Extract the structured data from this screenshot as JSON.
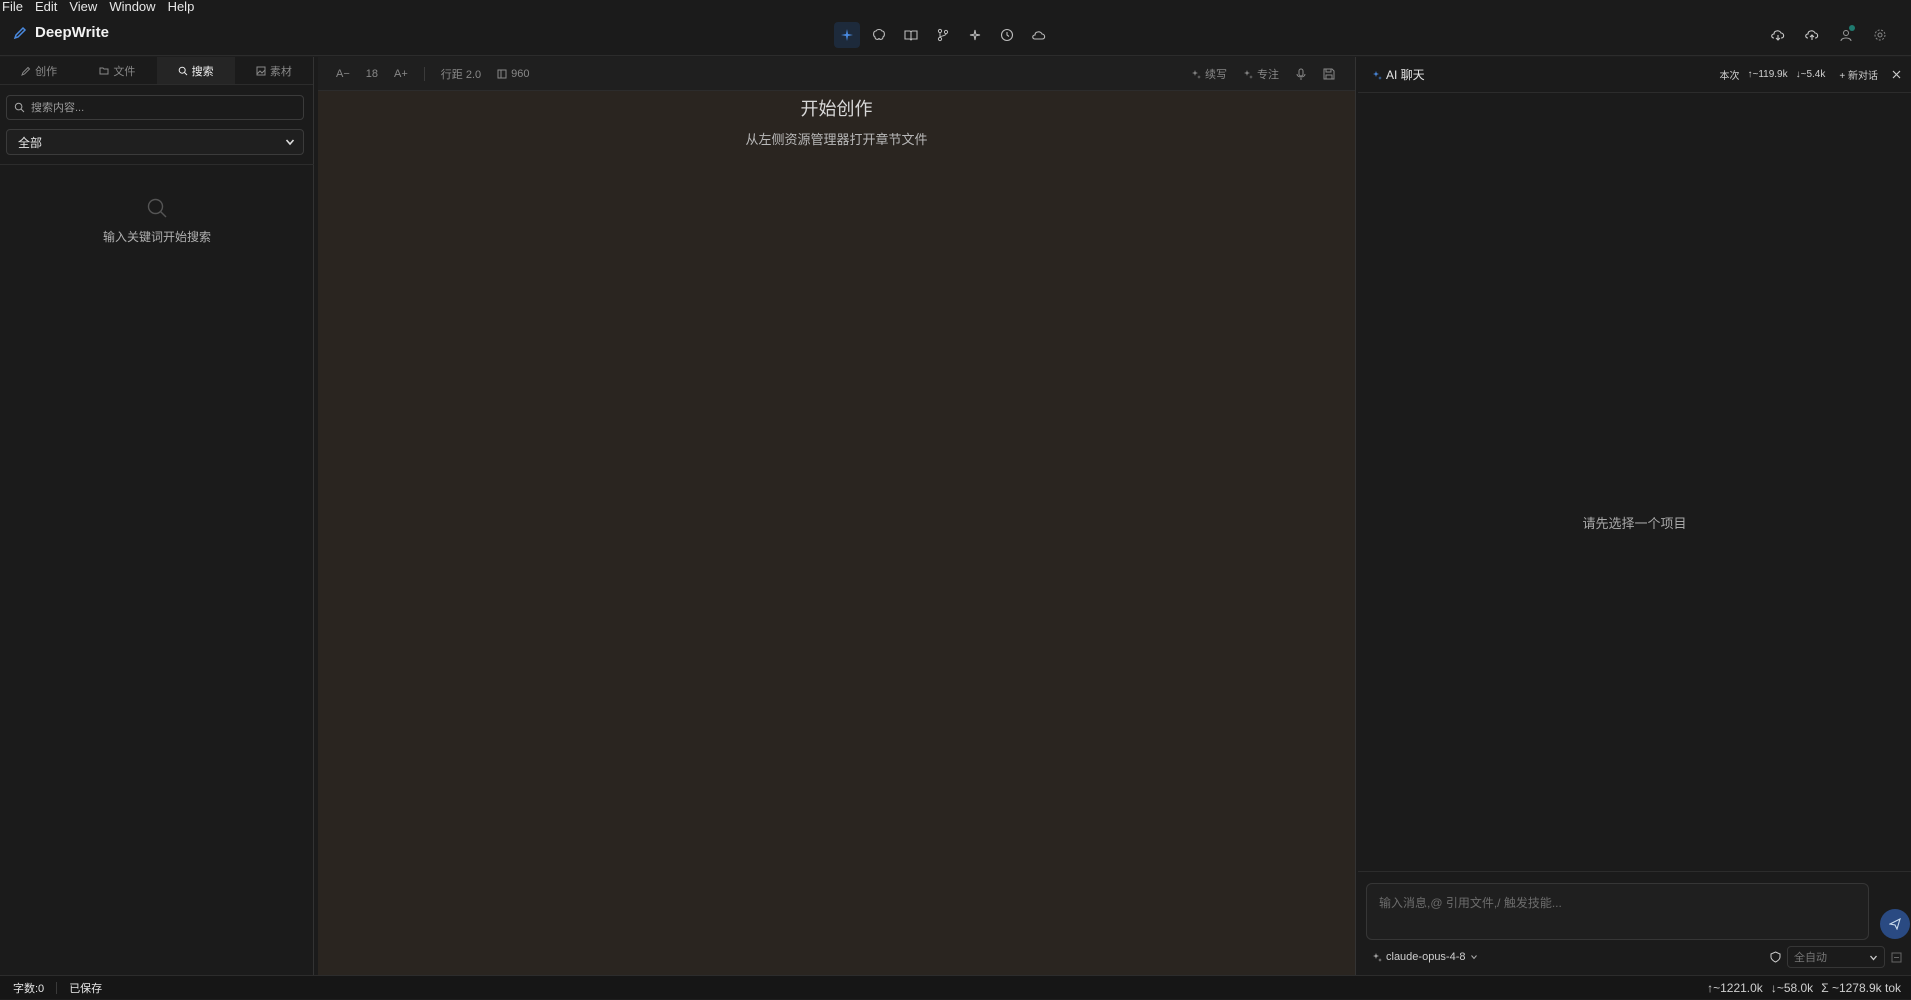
{
  "menubar": {
    "items": [
      "File",
      "Edit",
      "View",
      "Window",
      "Help"
    ]
  },
  "app": {
    "title": "DeepWrite"
  },
  "toolbar_icons": [
    "sparkles-icon",
    "brain-icon",
    "book-icon",
    "branch-icon",
    "magic-icon",
    "history-icon",
    "cloud-icon"
  ],
  "sidebar": {
    "tabs": [
      {
        "label": "创作",
        "icon": "pen-icon"
      },
      {
        "label": "文件",
        "icon": "folder-icon"
      },
      {
        "label": "搜索",
        "icon": "search-icon"
      },
      {
        "label": "素材",
        "icon": "image-icon"
      }
    ],
    "search_placeholder": "搜索内容...",
    "filter_value": "全部",
    "empty_text": "输入关键词开始搜索"
  },
  "editor": {
    "toolbar": {
      "font_decrease": "A−",
      "font_size": "18",
      "font_increase": "A+",
      "line_height": "行距 2.0",
      "width": "960",
      "continue_label": "续写",
      "focus_label": "专注"
    },
    "title": "开始创作",
    "subtitle": "从左侧资源管理器打开章节文件"
  },
  "chat": {
    "title": "AI 聊天",
    "session_label": "本次",
    "tokens_up": "↑~119.9k",
    "tokens_down": "↓~5.4k",
    "new_chat": "+ 新对话",
    "empty_text": "请先选择一个项目",
    "input_placeholder": "输入消息,@ 引用文件,/ 触发技能...",
    "model": "claude-opus-4-8",
    "mode": "全自动"
  },
  "statusbar": {
    "word_count": "字数:0",
    "save_status": "已保存",
    "total_up": "↑~1221.0k",
    "total_down": "↓~58.0k",
    "total": "Σ ~1278.9k tok"
  },
  "colors": {
    "accent": "#2a4a82",
    "editor_bg": "#2a2520",
    "panel_bg": "#1b1b1b"
  }
}
